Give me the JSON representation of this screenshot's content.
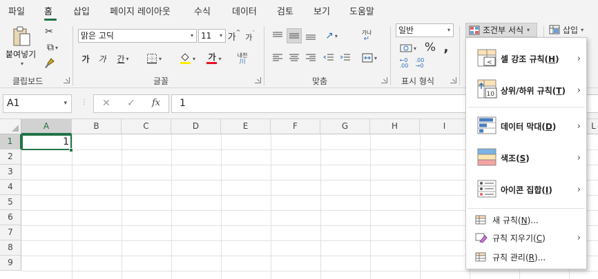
{
  "tabs": [
    "파일",
    "홈",
    "삽입",
    "페이지 레이아웃",
    "수식",
    "데이터",
    "검토",
    "보기",
    "도움말"
  ],
  "active_tab": "홈",
  "accent": "#217346",
  "clipboard": {
    "paste_label": "붙여넣기",
    "group_label": "클립보드"
  },
  "font": {
    "name": "맑은 고딕",
    "size": "11",
    "grow_label": "가",
    "shrink_label": "가",
    "bold_label": "가",
    "italic_label": "가",
    "underline_label": "간",
    "color_label": "가",
    "phonetic_label": "내천",
    "group_label": "글꼴"
  },
  "alignment": {
    "wrap_label": "가나",
    "group_label": "맞춤"
  },
  "number": {
    "format": "일반",
    "percent": "%",
    "comma": ",",
    "group_label": "표시 형식"
  },
  "styles": {
    "conditional_formatting": "조건부 서식"
  },
  "cells": {
    "insert_label": "삽입"
  },
  "formula_bar": {
    "name_box": "A1",
    "cancel": "✕",
    "enter": "✓",
    "fx": "fx",
    "value": "1"
  },
  "grid": {
    "columns": [
      "A",
      "B",
      "C",
      "D",
      "E",
      "F",
      "G",
      "H",
      "I",
      "",
      "",
      "L"
    ],
    "rows": [
      "1",
      "2",
      "3",
      "4",
      "5",
      "6",
      "7",
      "8",
      "9"
    ],
    "a1_value": "1"
  },
  "cf_menu": {
    "highlight": {
      "text": "셀 강조 규칙(",
      "key": "H",
      "end": ")"
    },
    "topbottom": {
      "text": "상위/하위 규칙(",
      "key": "T",
      "end": ")"
    },
    "databars": {
      "text": "데이터 막대(",
      "key": "D",
      "end": ")"
    },
    "colorscales": {
      "text": "색조(",
      "key": "S",
      "end": ")"
    },
    "iconsets": {
      "text": "아이콘 집합(",
      "key": "I",
      "end": ")"
    },
    "newrule": {
      "text": "새 규칙(",
      "key": "N",
      "end": ")..."
    },
    "clearrules": {
      "text": "규칙 지우기(",
      "key": "C",
      "end": ")"
    },
    "managerules": {
      "text": "규칙 관리(",
      "key": "R",
      "end": ")..."
    },
    "topbottom_icon_text": "10"
  }
}
